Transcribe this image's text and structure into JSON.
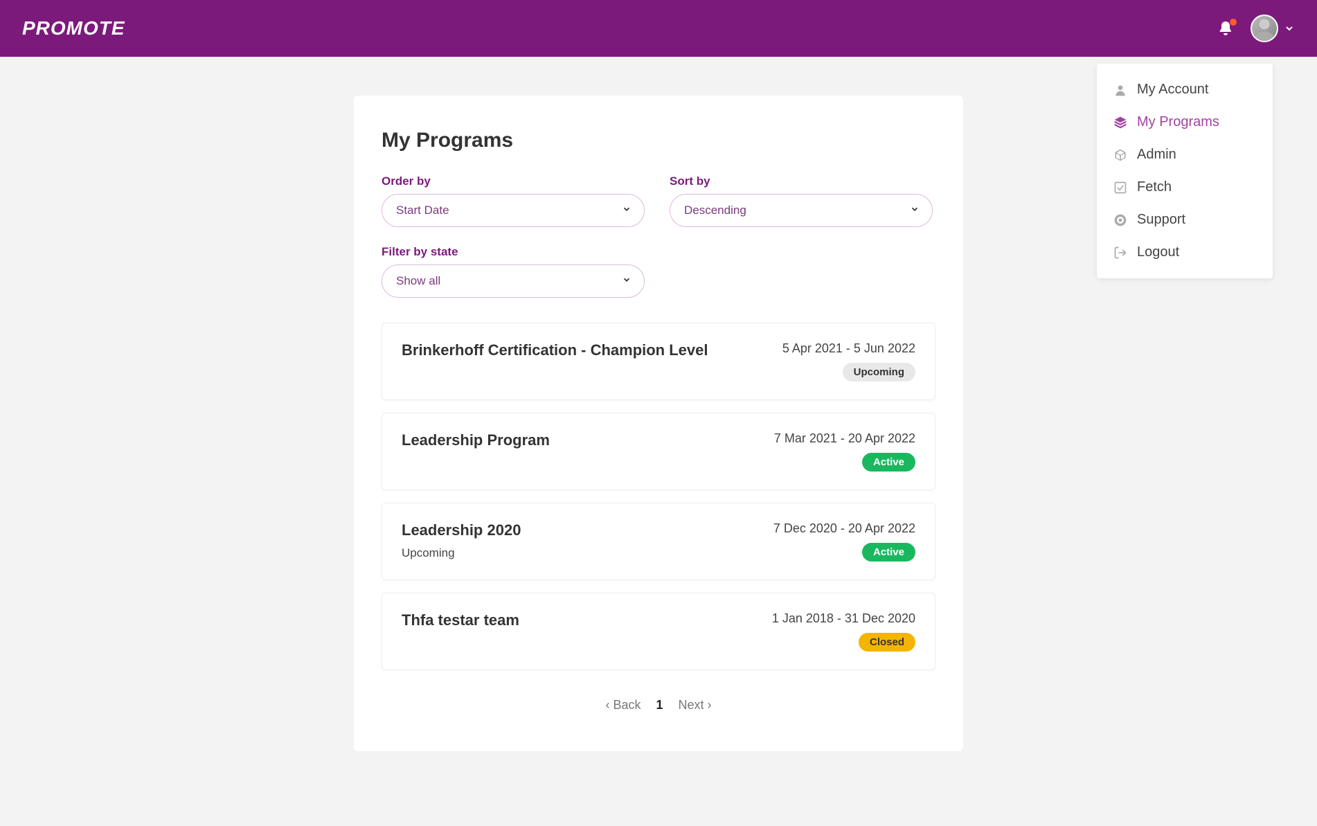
{
  "header": {
    "logo": "PROMOTE"
  },
  "user_menu": {
    "items": [
      {
        "label": "My Account",
        "icon": "user",
        "active": false
      },
      {
        "label": "My Programs",
        "icon": "layers",
        "active": true
      },
      {
        "label": "Admin",
        "icon": "cube",
        "active": false
      },
      {
        "label": "Fetch",
        "icon": "check",
        "active": false
      },
      {
        "label": "Support",
        "icon": "lifebuoy",
        "active": false
      },
      {
        "label": "Logout",
        "icon": "logout",
        "active": false
      }
    ]
  },
  "page": {
    "title": "My Programs",
    "filters": {
      "order_by": {
        "label": "Order by",
        "value": "Start Date"
      },
      "sort_by": {
        "label": "Sort by",
        "value": "Descending"
      },
      "filter_state": {
        "label": "Filter by state",
        "value": "Show all"
      }
    },
    "programs": [
      {
        "title": "Brinkerhoff Certification - Champion Level",
        "subtitle": "",
        "dates": "5 Apr 2021 - 5 Jun 2022",
        "status": "Upcoming",
        "status_class": "upcoming"
      },
      {
        "title": "Leadership Program",
        "subtitle": "",
        "dates": "7 Mar 2021 - 20 Apr 2022",
        "status": "Active",
        "status_class": "active"
      },
      {
        "title": "Leadership 2020",
        "subtitle": "Upcoming",
        "dates": "7 Dec 2020 - 20 Apr 2022",
        "status": "Active",
        "status_class": "active"
      },
      {
        "title": "Thfa testar team",
        "subtitle": "",
        "dates": "1 Jan 2018 - 31 Dec 2020",
        "status": "Closed",
        "status_class": "closed"
      }
    ],
    "pagination": {
      "back": "‹ Back",
      "current": "1",
      "next": "Next ›"
    }
  }
}
